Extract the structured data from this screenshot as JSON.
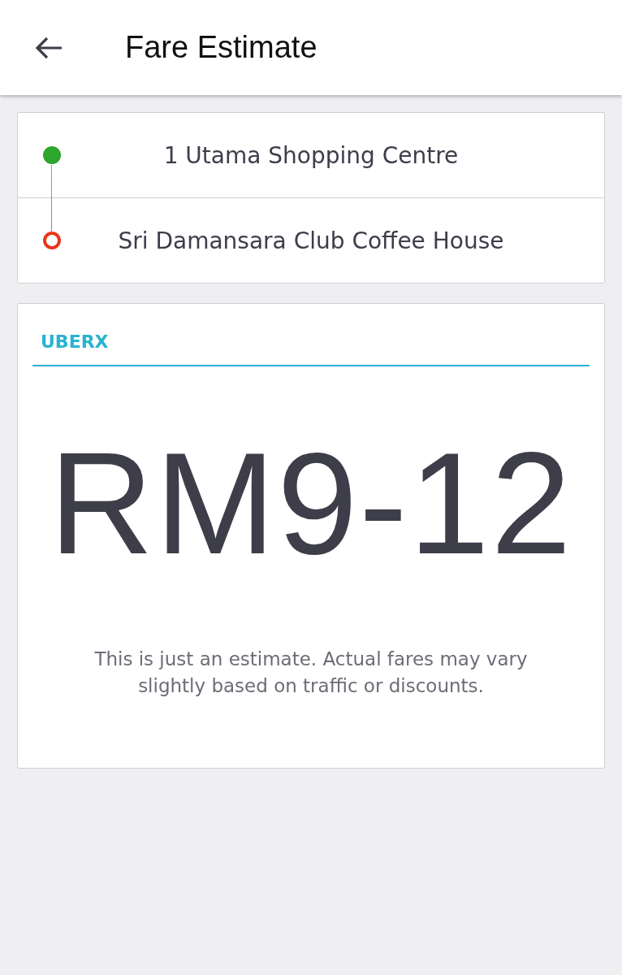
{
  "header": {
    "title": "Fare Estimate"
  },
  "route": [
    {
      "kind": "pickup",
      "name": "1 Utama Shopping Centre"
    },
    {
      "kind": "dropoff",
      "name": "Sri Damansara Club Coffee House"
    }
  ],
  "tabs": [
    {
      "label": "UBERX",
      "selected": true
    }
  ],
  "estimate": {
    "price": "RM9-12",
    "note": "This is just an estimate. Actual fares may vary slightly based on traffic or discounts."
  }
}
